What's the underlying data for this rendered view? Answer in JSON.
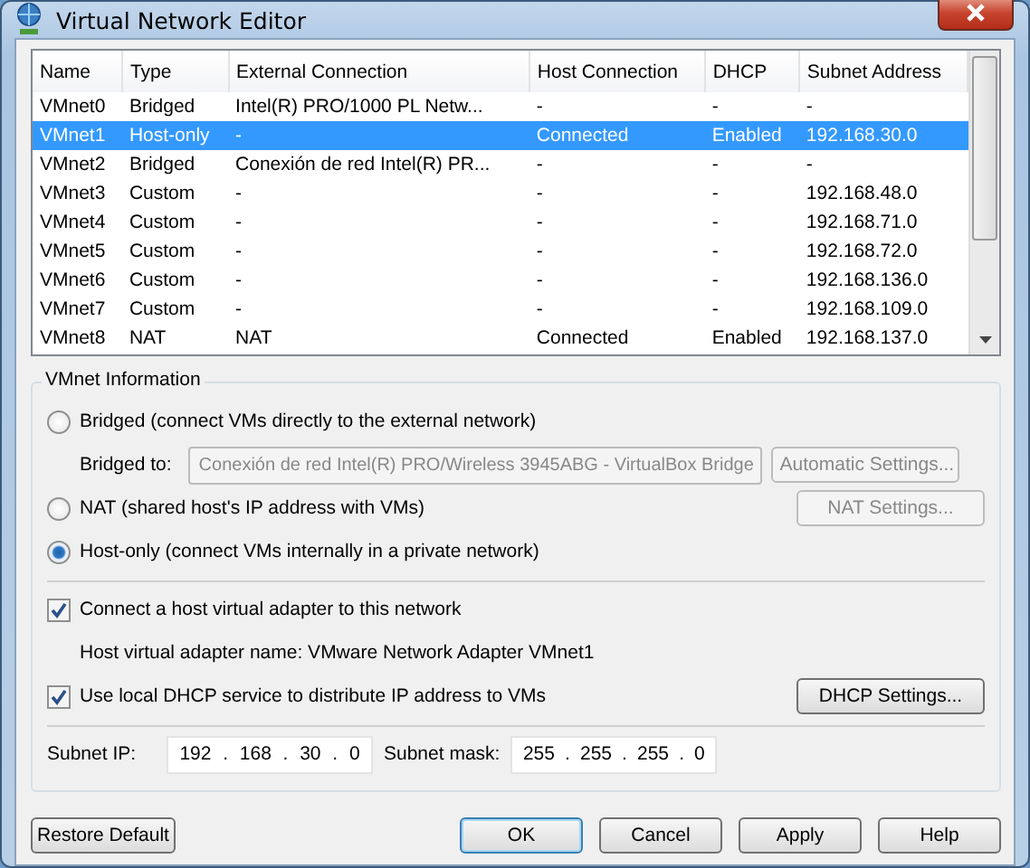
{
  "window": {
    "title": "Virtual Network Editor"
  },
  "table": {
    "columns": [
      "Name",
      "Type",
      "External Connection",
      "Host Connection",
      "DHCP",
      "Subnet Address"
    ],
    "rows": [
      {
        "cells": [
          "VMnet0",
          "Bridged",
          "Intel(R) PRO/1000 PL Netw...",
          "-",
          "-",
          "-"
        ],
        "selected": false
      },
      {
        "cells": [
          "VMnet1",
          "Host-only",
          "-",
          "Connected",
          "Enabled",
          "192.168.30.0"
        ],
        "selected": true
      },
      {
        "cells": [
          "VMnet2",
          "Bridged",
          "Conexión de red Intel(R) PR...",
          "-",
          "-",
          "-"
        ],
        "selected": false
      },
      {
        "cells": [
          "VMnet3",
          "Custom",
          "-",
          "-",
          "-",
          "192.168.48.0"
        ],
        "selected": false
      },
      {
        "cells": [
          "VMnet4",
          "Custom",
          "-",
          "-",
          "-",
          "192.168.71.0"
        ],
        "selected": false
      },
      {
        "cells": [
          "VMnet5",
          "Custom",
          "-",
          "-",
          "-",
          "192.168.72.0"
        ],
        "selected": false
      },
      {
        "cells": [
          "VMnet6",
          "Custom",
          "-",
          "-",
          "-",
          "192.168.136.0"
        ],
        "selected": false
      },
      {
        "cells": [
          "VMnet7",
          "Custom",
          "-",
          "-",
          "-",
          "192.168.109.0"
        ],
        "selected": false
      },
      {
        "cells": [
          "VMnet8",
          "NAT",
          "NAT",
          "Connected",
          "Enabled",
          "192.168.137.0"
        ],
        "selected": false
      }
    ]
  },
  "vmnet_info": {
    "title": "VMnet Information",
    "bridged": {
      "label": "Bridged (connect VMs directly to the external network)",
      "selected": false
    },
    "bridged_to": {
      "label": "Bridged to:",
      "value": "Conexión de red Intel(R) PRO/Wireless 3945ABG - VirtualBox Bridge",
      "disabled": true
    },
    "automatic_settings": {
      "label": "Automatic Settings...",
      "disabled": true
    },
    "nat": {
      "label": "NAT (shared host's IP address with VMs)",
      "selected": false
    },
    "nat_settings": {
      "label": "NAT Settings...",
      "disabled": true
    },
    "host_only": {
      "label": "Host-only (connect VMs internally in a private network)",
      "selected": true
    },
    "connect_adapter": {
      "label": "Connect a host virtual adapter to this network",
      "checked": true
    },
    "adapter_name": "Host virtual adapter name: VMware Network Adapter VMnet1",
    "use_dhcp": {
      "label": "Use local DHCP service to distribute IP address to VMs",
      "checked": true
    },
    "dhcp_settings": {
      "label": "DHCP Settings...",
      "disabled": false
    },
    "subnet_ip": {
      "label": "Subnet IP:",
      "octets": [
        "192",
        "168",
        "30",
        "0"
      ],
      "separator": "."
    },
    "subnet_mask": {
      "label": "Subnet mask:",
      "octets": [
        "255",
        "255",
        "255",
        "0"
      ],
      "separator": "."
    }
  },
  "buttons": [
    {
      "label": "Restore Default",
      "kind": "left"
    },
    {
      "label": "OK",
      "kind": "default"
    },
    {
      "label": "Cancel",
      "kind": "normal"
    },
    {
      "label": "Apply",
      "kind": "normal"
    },
    {
      "label": "Help",
      "kind": "normal"
    }
  ]
}
